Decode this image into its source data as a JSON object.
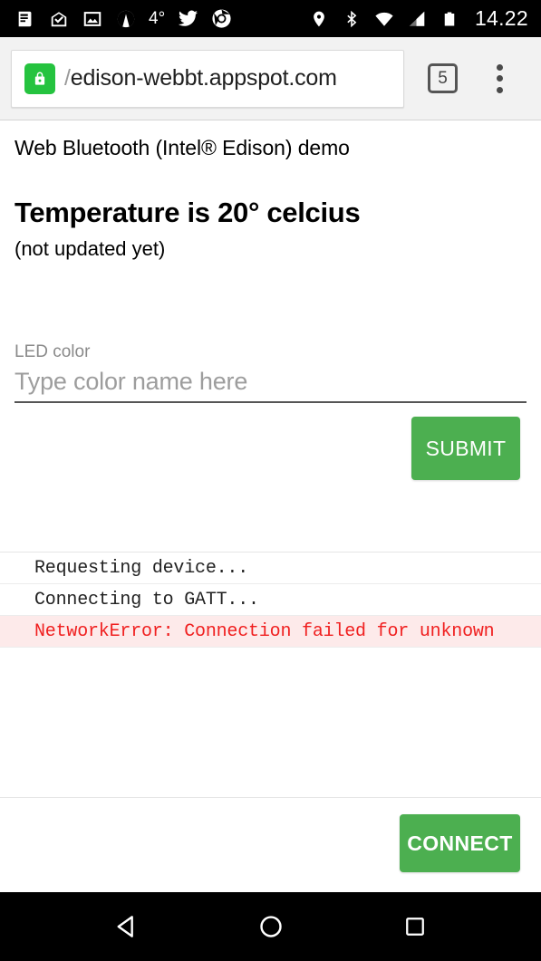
{
  "statusbar": {
    "icons_left": [
      {
        "name": "news-icon"
      },
      {
        "name": "inbox-check-icon"
      },
      {
        "name": "photo-icon"
      },
      {
        "name": "app-circle-icon"
      },
      {
        "name": "weather-temp"
      },
      {
        "name": "twitter-icon"
      },
      {
        "name": "chrome-icon"
      }
    ],
    "temperature": "4°",
    "icons_right": [
      {
        "name": "location-pin-icon"
      },
      {
        "name": "bluetooth-icon"
      },
      {
        "name": "wifi-icon"
      },
      {
        "name": "cell-signal-icon"
      },
      {
        "name": "battery-icon"
      }
    ],
    "clock": "14.22"
  },
  "browser": {
    "lock_icon": "lock-icon",
    "url_prefix": "/",
    "url": "edison-webbt.appspot.com",
    "tab_count": "5",
    "menu_icon": "overflow-menu-icon"
  },
  "page": {
    "demo_title": "Web Bluetooth (Intel® Edison) demo",
    "temperature_heading": "Temperature is 20° celcius",
    "temperature_sub": "(not updated yet)",
    "led_field": {
      "label": "LED color",
      "placeholder": "Type color name here",
      "value": ""
    },
    "submit_label": "SUBMIT",
    "connect_label": "CONNECT",
    "log": [
      {
        "text": "Requesting device...",
        "level": "info"
      },
      {
        "text": "Connecting to GATT...",
        "level": "info"
      },
      {
        "text": "NetworkError: Connection failed for unknown",
        "level": "error"
      }
    ]
  },
  "navbar": {
    "back": "back-triangle-icon",
    "home": "home-circle-icon",
    "recents": "recents-square-icon"
  },
  "colors": {
    "accent_green": "#4caf50",
    "lock_green": "#25c33f",
    "error_red": "#f02020",
    "error_bg": "#fdeaea",
    "chrome_bg": "#f2f2f2"
  }
}
